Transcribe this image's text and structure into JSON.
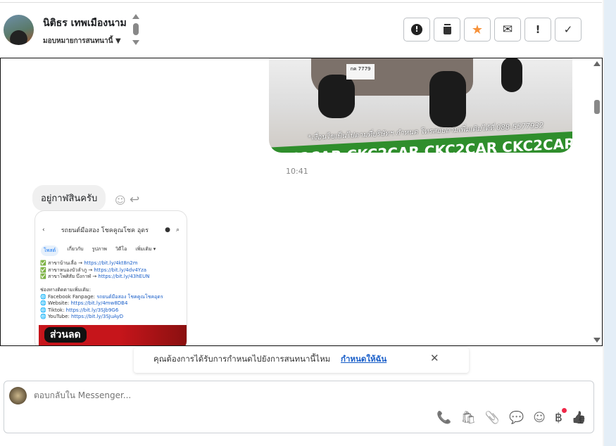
{
  "header": {
    "contact_name": "นิติธร เทพเมืองนาม",
    "assign_label": "มอบหมายการสนทนานี้",
    "actions": [
      {
        "name": "spam",
        "glyph": "❗"
      },
      {
        "name": "delete",
        "glyph": "🗑"
      },
      {
        "name": "star",
        "glyph": "★"
      },
      {
        "name": "mark-unread",
        "glyph": "✉"
      },
      {
        "name": "follow-up",
        "glyph": "!"
      },
      {
        "name": "done",
        "glyph": "✓"
      }
    ]
  },
  "messages": {
    "car_image": {
      "plate": "กค 7779",
      "note": "*เงื่อนไขเป็นไปตามที่บริษัทฯ กำหนด โทรสอบถามเพิ่มเติมได้ที่ 088-5577932",
      "banner": "CKC2CAR CKC2CAR CKC2CAR CKC2CAR CKC2"
    },
    "time": "10:41",
    "incoming_text": "อยู่กาฬสินครับ",
    "screenshot": {
      "page_title": "รถยนต์มือสอง โชคคูณโชค อุดร",
      "tabs": [
        "โพสต์",
        "เกี่ยวกับ",
        "รูปภาพ",
        "วิดีโอ",
        "เพิ่มเติม ▾"
      ],
      "branches": [
        {
          "label": "✅ สาขาบ้านเลื่อ → ",
          "link": "https://bit.ly/4kt8n2m"
        },
        {
          "label": "✅ สาขาหนองบัวลำภู → ",
          "link": "https://bit.ly/4dv4Yza"
        },
        {
          "label": "✅ สาขาโพศิสัย บึงกาฬ → ",
          "link": "https://bit.ly/43hEUN"
        }
      ],
      "contact_heading": "ช่องทางติดตามเพิ่มเติม:",
      "channels": [
        {
          "label": "🌐 Facebook Fanpage: ",
          "link": "รถยนต์มือสอง โชคคูณโชคอุดร"
        },
        {
          "label": "🌐 Website: ",
          "link": "https://bit.ly/4mw8DB4"
        },
        {
          "label": "🌐 Tiktok: ",
          "link": "https://bit.ly/3SJb9G6"
        },
        {
          "label": "🌐 YouTube: ",
          "link": "https://bit.ly/3SJuAyD"
        }
      ],
      "promo": "ส่วนลด"
    }
  },
  "notice": {
    "text": "คุณต้องการได้รับการกำหนดไปยังการสนทนานี้ไหม",
    "link": "กำหนดให้ฉัน",
    "close": "✕"
  },
  "composer": {
    "placeholder": "ตอบกลับใน Messenger...",
    "tools": [
      {
        "name": "call-add",
        "glyph": "📞"
      },
      {
        "name": "shop",
        "glyph": "🛍"
      },
      {
        "name": "attach",
        "glyph": "📎"
      },
      {
        "name": "saved-replies",
        "glyph": "💬"
      },
      {
        "name": "emoji",
        "glyph": "☺"
      },
      {
        "name": "payment",
        "glyph": "฿"
      },
      {
        "name": "like",
        "glyph": "👍"
      }
    ]
  }
}
